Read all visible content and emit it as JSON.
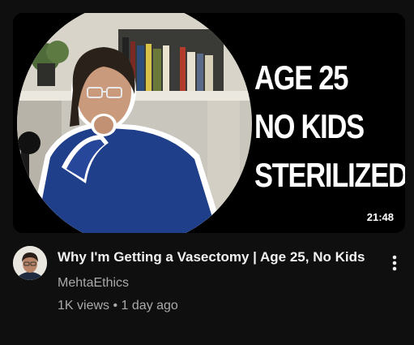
{
  "video": {
    "thumbnail": {
      "overlay_lines": [
        "AGE 25",
        "NO KIDS",
        "STERILIZED"
      ],
      "duration": "21:48"
    },
    "title": "Why I'm Getting a Vasectomy | Age 25, No Kids",
    "channel": "MehtaEthics",
    "views": "1K views",
    "separator": "•",
    "age": "1 day ago",
    "menu_icon": "more-vert-icon",
    "avatar_icon": "channel-avatar"
  },
  "colors": {
    "background": "#0f0f0f",
    "title": "#f1f1f1",
    "secondary_text": "#aaaaaa"
  }
}
